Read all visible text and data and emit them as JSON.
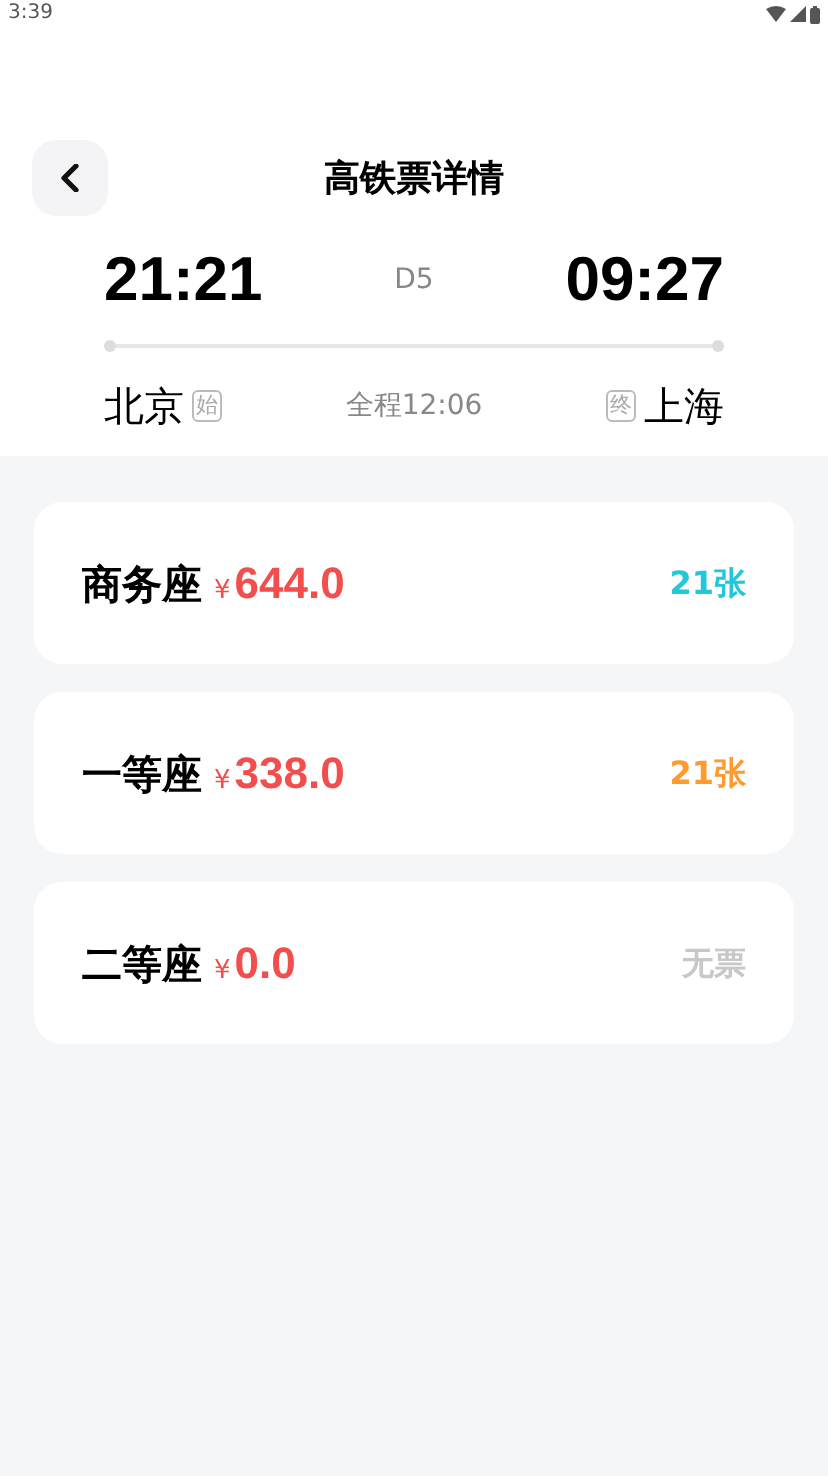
{
  "status_bar": {
    "time": "3:39"
  },
  "header": {
    "title": "高铁票详情"
  },
  "trip": {
    "depart_time": "21:21",
    "train": "D5",
    "arrive_time": "09:27",
    "from": "北京",
    "from_tag": "始",
    "duration": "全程12:06",
    "to_tag": "终",
    "to": "上海"
  },
  "seats": [
    {
      "name": "商务座",
      "currency": "¥",
      "price": "644.0",
      "availability": "21张",
      "color": "#22c7d9"
    },
    {
      "name": "一等座",
      "currency": "¥",
      "price": "338.0",
      "availability": "21张",
      "color": "#ff9a2e"
    },
    {
      "name": "二等座",
      "currency": "¥",
      "price": "0.0",
      "availability": "无票",
      "color": "#c8c8c8"
    }
  ]
}
